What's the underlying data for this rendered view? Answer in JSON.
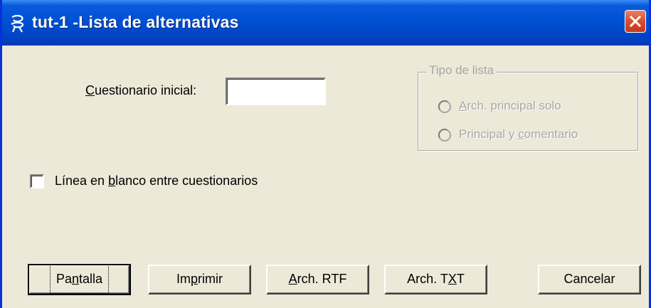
{
  "window": {
    "title": "tut-1 -Lista de alternativas",
    "icon": "app-glyph-icon",
    "close_icon": "close-icon",
    "accent": "#0052d6"
  },
  "form": {
    "cuestionario": {
      "label_pre": "",
      "label_accel": "C",
      "label_post": "uestionario inicial:",
      "value": ""
    },
    "tipo_lista": {
      "legend": "Tipo de lista",
      "options": [
        {
          "pre": "",
          "accel": "A",
          "post": "rch. principal solo",
          "selected": false,
          "enabled": false
        },
        {
          "pre": "Principal y ",
          "accel": "c",
          "post": "omentario",
          "selected": false,
          "enabled": false
        }
      ]
    },
    "linea_blanco": {
      "pre": "Línea en ",
      "accel": "b",
      "post": "lanco entre cuestionarios",
      "checked": false
    }
  },
  "buttons": {
    "pantalla": {
      "pre": "Pa",
      "accel": "n",
      "post": "talla"
    },
    "imprimir": {
      "pre": "Im",
      "accel": "p",
      "post": "rimir"
    },
    "rtf": {
      "pre": "",
      "accel": "A",
      "post": "rch. RTF"
    },
    "txt": {
      "pre": "Arch. T",
      "accel": "X",
      "post": "T"
    },
    "cancelar": {
      "pre": "Cancelar",
      "accel": "",
      "post": ""
    }
  }
}
